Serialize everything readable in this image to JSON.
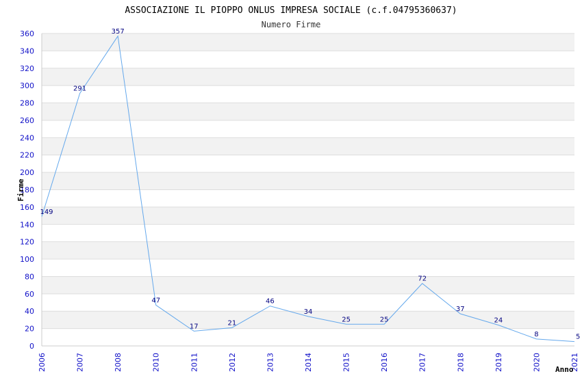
{
  "chart_data": {
    "type": "line",
    "title": "ASSOCIAZIONE IL PIOPPO ONLUS IMPRESA SOCIALE (c.f.04795360637)",
    "subtitle": "Numero Firme",
    "xlabel": "Anno",
    "ylabel": "Firme",
    "categories": [
      "2006",
      "2007",
      "2008",
      "2010",
      "2011",
      "2012",
      "2013",
      "2014",
      "2015",
      "2016",
      "2017",
      "2018",
      "2019",
      "2020",
      "2021"
    ],
    "series": [
      {
        "values": [
          149,
          291,
          357,
          47,
          17,
          21,
          46,
          34,
          25,
          25,
          72,
          37,
          24,
          8,
          5
        ]
      }
    ],
    "yticks": [
      0,
      20,
      40,
      60,
      80,
      100,
      120,
      140,
      160,
      180,
      200,
      220,
      240,
      260,
      280,
      300,
      320,
      340,
      360
    ],
    "ylim": [
      0,
      360
    ],
    "grid": true,
    "data_labels": true,
    "colors": {
      "line": "#64a8ec",
      "band": "#f2f2f2",
      "grid": "#dddddd",
      "tick_text": "#1010c8",
      "label_text": "#000080"
    }
  }
}
